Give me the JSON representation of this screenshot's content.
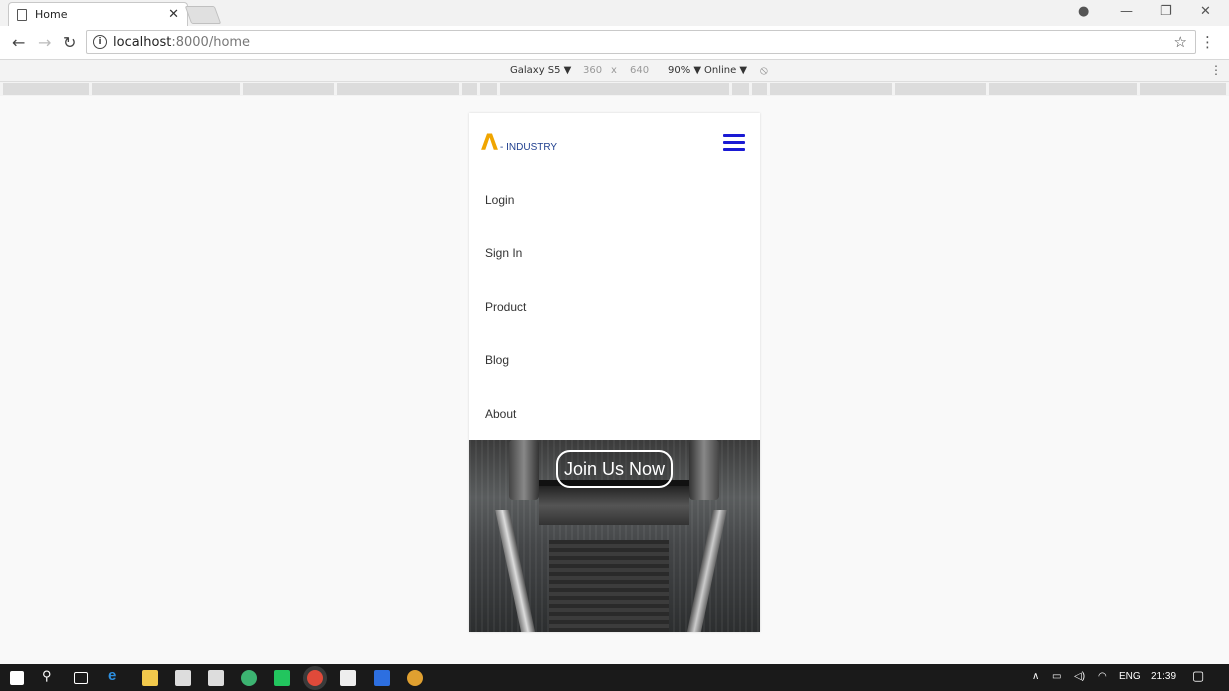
{
  "browser": {
    "tab_title": "Home",
    "url_host": "localhost",
    "url_path": ":8000/home"
  },
  "device_toolbar": {
    "device": "Galaxy S5 ▼",
    "width": "360",
    "times": "x",
    "height": "640",
    "zoom": "90% ▼",
    "network": "Online ▼"
  },
  "site": {
    "brand_mark": "Λ",
    "brand_text": "- INDUSTRY",
    "menu": [
      {
        "label": "Login"
      },
      {
        "label": "Sign In"
      },
      {
        "label": "Product"
      },
      {
        "label": "Blog"
      },
      {
        "label": "About"
      }
    ],
    "cta": "Join Us Now"
  },
  "taskbar": {
    "lang": "ENG",
    "time": "21:39"
  },
  "colors": {
    "brand_accent": "#f0a500",
    "brand_text": "#1f3f8f",
    "hamburger": "#1a1ad4"
  }
}
